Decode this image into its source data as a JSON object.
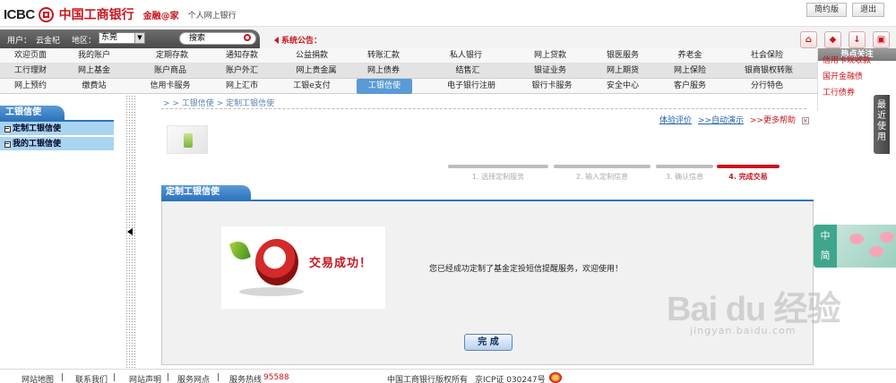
{
  "header": {
    "logo_en": "ICBC",
    "logo_cn": "中国工商银行",
    "sub1": "金融@家",
    "sub2": "个人网上银行",
    "btn_simplified": "简约版",
    "btn_logout": "退出"
  },
  "userbar": {
    "user_label": "用户：",
    "user_name": "云金杞",
    "region_label": "地区：",
    "region_value": "东莞",
    "search_placeholder": "搜索",
    "notice": "系统公告："
  },
  "top_icons": [
    "home-icon",
    "cart-icon",
    "download-icon",
    "lock-icon"
  ],
  "nav": {
    "row1": [
      "欢迎页面",
      "我的账户",
      "定期存款",
      "通知存款",
      "公益捐款",
      "转账汇款",
      "私人银行",
      "网上贷款",
      "银医服务",
      "养老金",
      "社会保险"
    ],
    "row2": [
      "工行理财",
      "网上基金",
      "账户商品",
      "账户外汇",
      "网上贵金属",
      "网上债券",
      "结售汇",
      "银证业务",
      "网上期货",
      "网上保险",
      "银商银权转账"
    ],
    "row3": [
      "网上预约",
      "缴费站",
      "信用卡服务",
      "网上汇市",
      "工银e支付",
      "工银信使",
      "电子银行注册",
      "银行卡服务",
      "安全中心",
      "客户服务",
      "分行特色"
    ],
    "active_row3_index": 5
  },
  "hot": {
    "title": "热点关注",
    "items": [
      "信用卡现收款",
      "国开金融债",
      "工行债券"
    ]
  },
  "sidebar": {
    "title": "工银信使",
    "items": [
      "定制工银信使",
      "我的工银信使"
    ]
  },
  "main": {
    "breadcrumb": "> > 工银信使 > 定制工银信使",
    "help_links": [
      "体验评价",
      ">>自动演示",
      ">>更多帮助"
    ],
    "steps": [
      "1. 选择定制服务",
      "2. 输入定制信息",
      "3. 确认信息",
      "4. 完成交易"
    ],
    "panel_title": "定制工银信使",
    "success_title": "交易成功！",
    "message": "您已经成功定制了基金定投短信提醒服务，欢迎使用！",
    "done_button": "完  成"
  },
  "float": {
    "recent": "最近使用",
    "zj_1": "中",
    "zj_2": "简"
  },
  "watermark": {
    "text": "Bai du 经验",
    "sub": "jingyan.baidu.com"
  },
  "footer": {
    "links": [
      "网站地图",
      "联系我们",
      "网站声明",
      "服务网点"
    ],
    "hotline_label": "服务热线",
    "hotline": "95588",
    "copyright": "中国工商银行版权所有",
    "icp": "京ICP证 030247号"
  },
  "colors": {
    "brand_red": "#c8161d",
    "nav_active": "#5a9ad6",
    "sidebar_item": "#a9d4f2"
  }
}
